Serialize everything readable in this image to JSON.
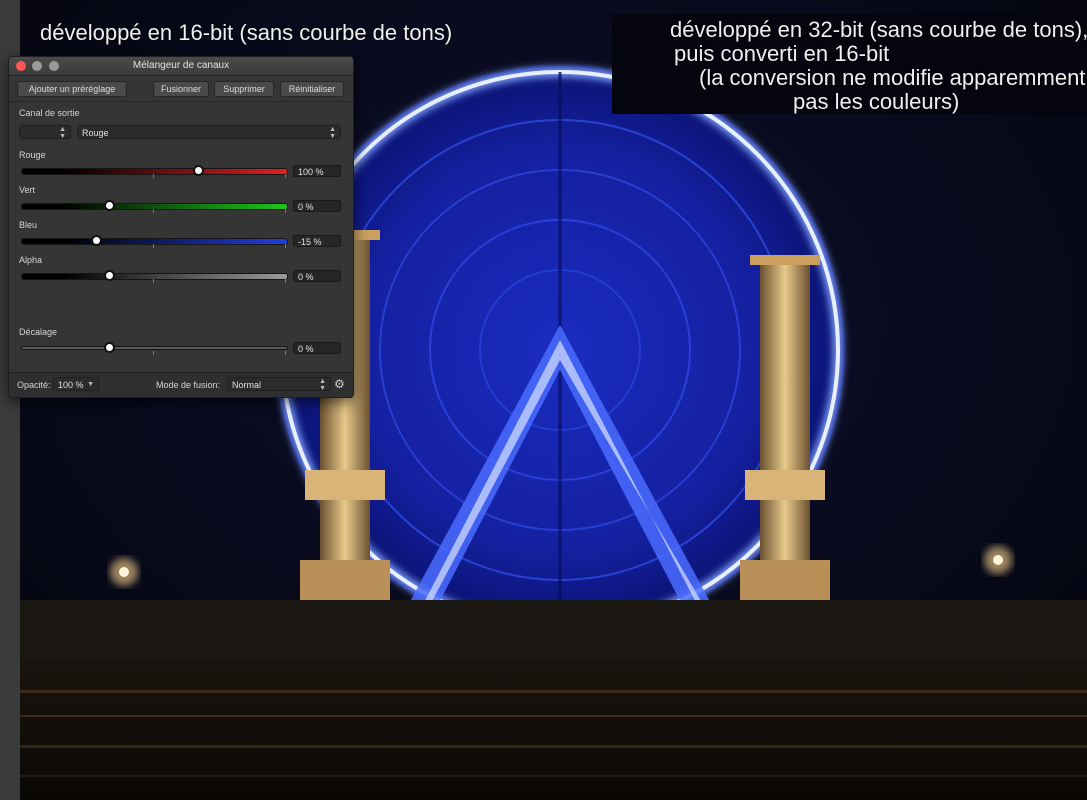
{
  "captions": {
    "left": "développé en 16-bit (sans courbe de tons)",
    "right_lines": [
      "développé en 32-bit (sans courbe de tons),",
      "puis converti en 16-bit",
      "(la conversion ne modifie apparemment",
      "pas les couleurs)"
    ]
  },
  "panel": {
    "title": "Mélangeur de canaux",
    "buttons": {
      "add_preset": "Ajouter un préréglage",
      "merge": "Fusionner",
      "delete": "Supprimer",
      "reset": "Réinitialiser"
    },
    "output_channel_label": "Canal de sortie",
    "output_channel_value": "Rouge",
    "channels": [
      {
        "label": "Rouge",
        "value": "100 %",
        "level": 100,
        "color": "#e02020"
      },
      {
        "label": "Vert",
        "value": "0 %",
        "level": 0,
        "color": "#1ec81e"
      },
      {
        "label": "Bleu",
        "value": "-15 %",
        "level": -15,
        "color": "#2040e0"
      },
      {
        "label": "Alpha",
        "value": "0 %",
        "level": 0,
        "color": "#9a9a9a"
      }
    ],
    "offset": {
      "label": "Décalage",
      "value": "0 %",
      "level": 0
    },
    "footer": {
      "opacity_label": "Opacité:",
      "opacity_value": "100 %",
      "blend_label": "Mode de fusion:",
      "blend_value": "Normal"
    },
    "icons": [
      "close-icon",
      "minimize-icon",
      "zoom-icon",
      "gear-icon"
    ]
  }
}
